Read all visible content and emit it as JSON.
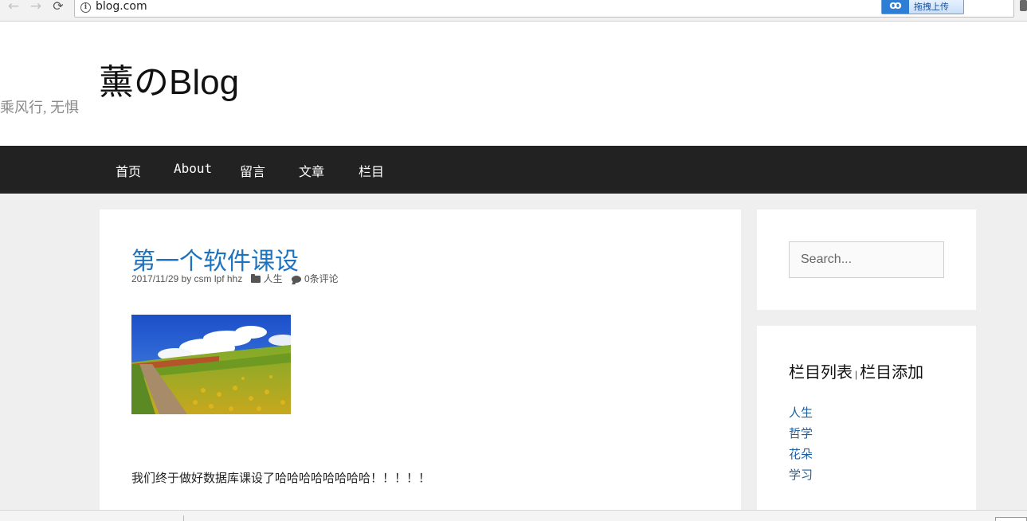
{
  "browser": {
    "url": "blog.com",
    "extension_label": "拖拽上传"
  },
  "header": {
    "site_title": "薰のBlog",
    "tagline": "乘风行, 无惧"
  },
  "nav": {
    "items": [
      {
        "label": "首页"
      },
      {
        "label": "About"
      },
      {
        "label": "留言"
      },
      {
        "label": "文章"
      },
      {
        "label": "栏目"
      }
    ]
  },
  "post": {
    "title": "第一个软件课设",
    "date": "2017/11/29",
    "by": "by",
    "author": "csm lpf hhz",
    "category": "人生",
    "comments": "0条评论",
    "body": "我们终于做好数据库课设了哈哈哈哈哈哈哈哈！！！！！"
  },
  "sidebar": {
    "search_placeholder": "Search...",
    "category_widget": {
      "title_left": "栏目列表",
      "separator": "|",
      "title_right": "栏目添加",
      "items": [
        {
          "label": "人生"
        },
        {
          "label": "哲学"
        },
        {
          "label": "花朵"
        },
        {
          "label": "学习"
        }
      ]
    }
  }
}
